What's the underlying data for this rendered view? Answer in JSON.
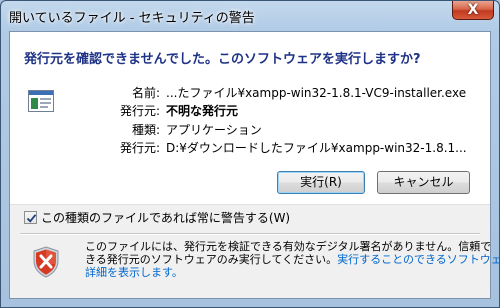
{
  "window": {
    "title": "開いているファイル - セキュリティの警告",
    "close_label": "X"
  },
  "dialog": {
    "heading": "発行元を確認できませんでした。このソフトウェアを実行しますか?",
    "info": [
      {
        "label": "名前:",
        "value": "...たファイル¥xampp-win32-1.8.1-VC9-installer.exe",
        "bold": false
      },
      {
        "label": "発行元:",
        "value": "不明な発行元",
        "bold": true
      },
      {
        "label": "種類:",
        "value": "アプリケーション",
        "bold": false
      },
      {
        "label": "発行元:",
        "value": "D:¥ダウンロードしたファイル¥xampp-win32-1.8.1...",
        "bold": false
      }
    ],
    "buttons": {
      "run": "実行(R)",
      "cancel": "キャンセル"
    },
    "checkbox": {
      "label": "この種類のファイルであれば常に警告する(W)",
      "checked": true
    },
    "warning": {
      "line1": "このファイルには、発行元を検証できる有効なデジタル署名がありません。信頼で",
      "line2_text": "きる発行元のソフトウェアのみ実行してください。",
      "line2_link": "実行することのできるソフトウェアの",
      "line3_link": "詳細を表示します。"
    }
  },
  "colors": {
    "heading": "#1e3287",
    "link": "#0066cc",
    "close_button": "#c0391e"
  },
  "icons": {
    "app": "application-window-icon",
    "warning": "shield-error-icon",
    "close": "close-icon"
  }
}
